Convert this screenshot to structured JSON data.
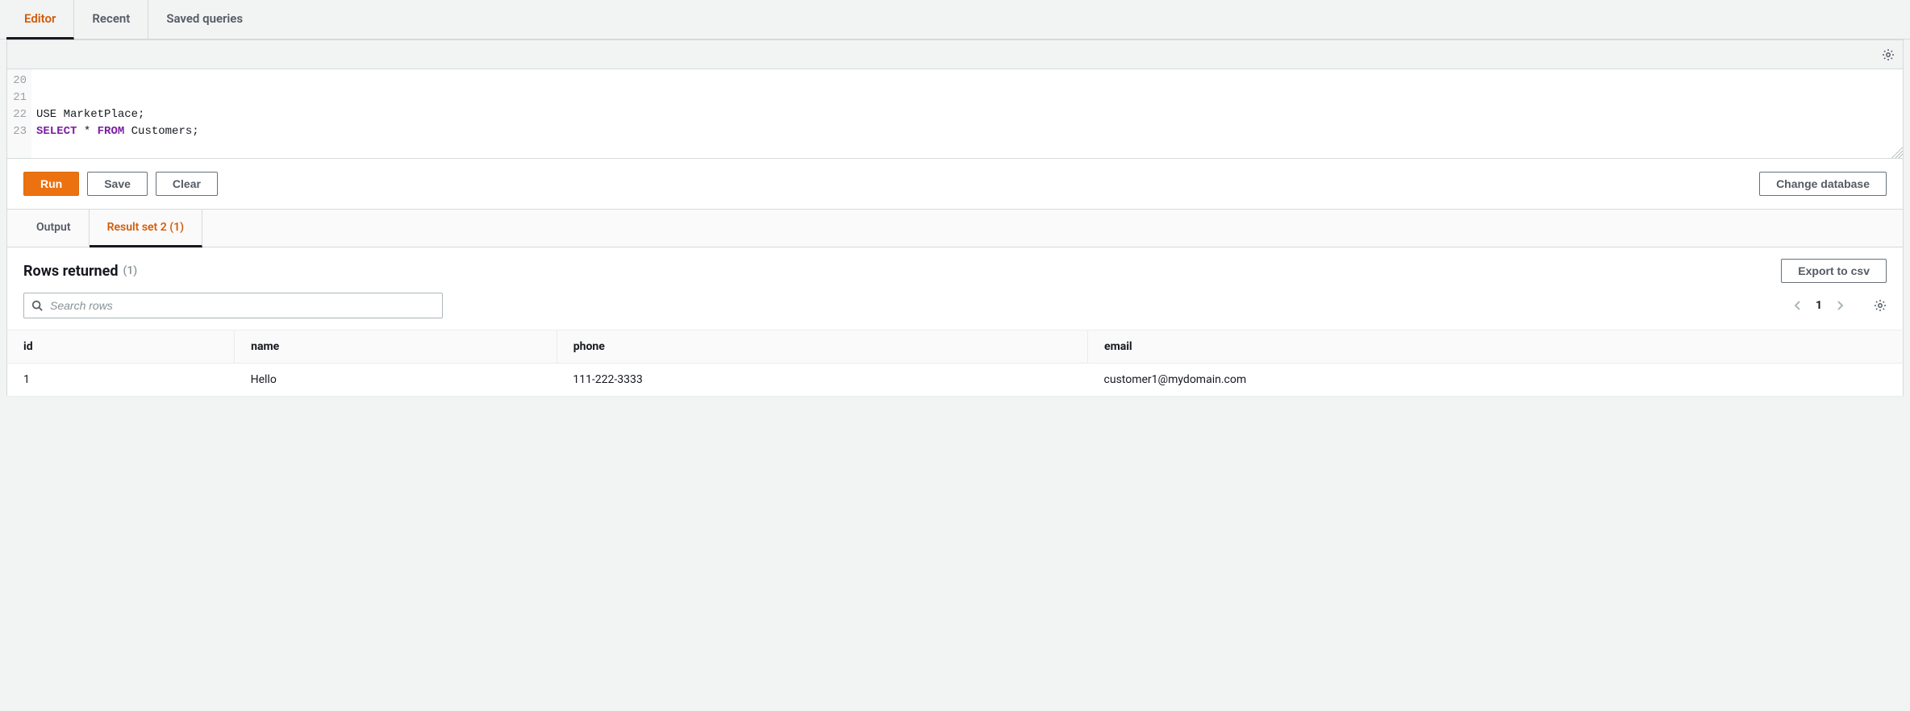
{
  "topTabs": {
    "editor": "Editor",
    "recent": "Recent",
    "saved": "Saved queries"
  },
  "editor": {
    "lines": [
      20,
      21,
      22,
      23
    ],
    "line22_plain": "USE MarketPlace;",
    "line23_kw1": "SELECT",
    "line23_mid": " * ",
    "line23_kw2": "FROM",
    "line23_rest": " Customers;"
  },
  "actions": {
    "run": "Run",
    "save": "Save",
    "clear": "Clear",
    "changeDb": "Change database"
  },
  "resultTabs": {
    "output": "Output",
    "resultSet": "Result set 2 (1)"
  },
  "results": {
    "title": "Rows returned",
    "count": "(1)",
    "exportCsv": "Export to csv",
    "searchPlaceholder": "Search rows",
    "page": "1",
    "columns": [
      "id",
      "name",
      "phone",
      "email"
    ],
    "rows": [
      {
        "id": "1",
        "name": "Hello",
        "phone": "111-222-3333",
        "email": "customer1@mydomain.com"
      }
    ]
  }
}
